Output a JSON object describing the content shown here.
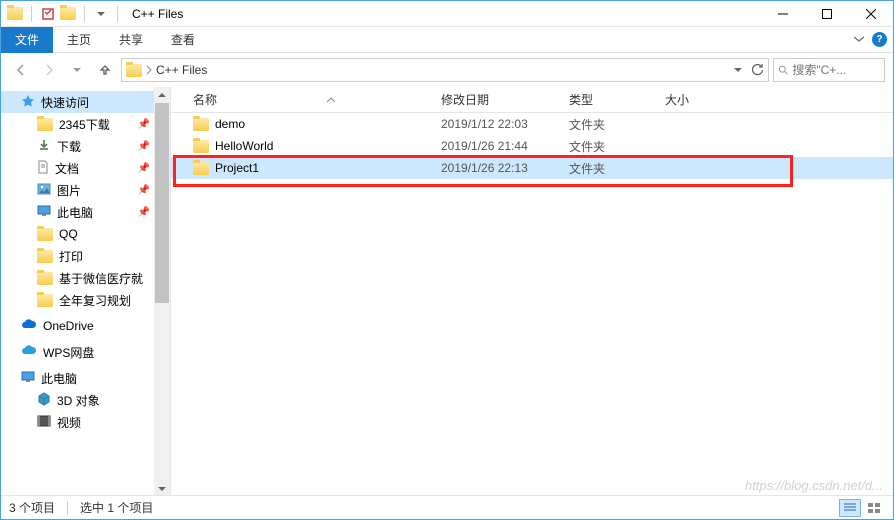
{
  "title": "C++ Files",
  "ribbon": {
    "file": "文件",
    "tabs": [
      "主页",
      "共享",
      "查看"
    ]
  },
  "address": {
    "path_text": "C++ Files"
  },
  "search": {
    "placeholder": "搜索\"C+..."
  },
  "sidebar": {
    "quick_access": "快速访问",
    "items_quick": [
      {
        "label": "2345下载",
        "pinned": true
      },
      {
        "label": "下载",
        "pinned": true
      },
      {
        "label": "文档",
        "pinned": true
      },
      {
        "label": "图片",
        "pinned": true
      },
      {
        "label": "此电脑",
        "pinned": true
      },
      {
        "label": "QQ",
        "pinned": false
      },
      {
        "label": "打印",
        "pinned": false
      },
      {
        "label": "基于微信医疗就",
        "pinned": false
      },
      {
        "label": "全年复习规划",
        "pinned": false
      }
    ],
    "onedrive": "OneDrive",
    "wps": "WPS网盘",
    "this_pc": "此电脑",
    "items_pc": [
      {
        "label": "3D 对象"
      },
      {
        "label": "视频"
      }
    ]
  },
  "columns": {
    "name": "名称",
    "date": "修改日期",
    "type": "类型",
    "size": "大小"
  },
  "rows": [
    {
      "name": "demo",
      "date": "2019/1/12 22:03",
      "type": "文件夹",
      "selected": false
    },
    {
      "name": "HelloWorld",
      "date": "2019/1/26 21:44",
      "type": "文件夹",
      "selected": false
    },
    {
      "name": "Project1",
      "date": "2019/1/26 22:13",
      "type": "文件夹",
      "selected": true
    }
  ],
  "status": {
    "count": "3 个项目",
    "selection": "选中 1 个项目"
  },
  "watermark": "https://blog.csdn.net/d..."
}
